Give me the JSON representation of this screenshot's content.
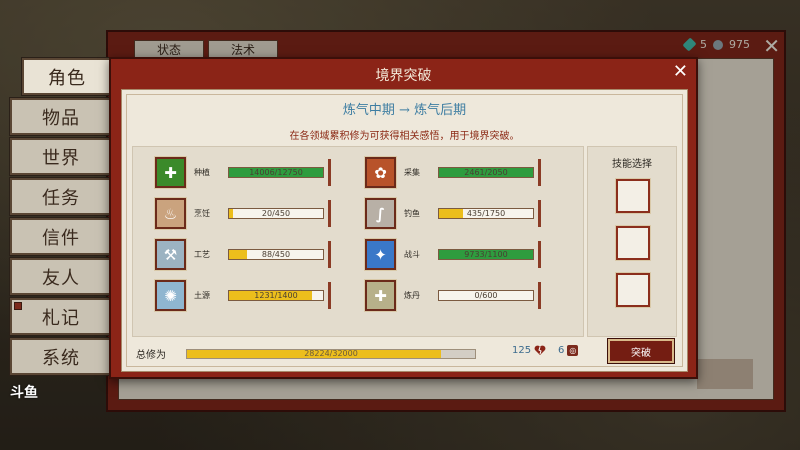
{
  "nav": {
    "items": [
      {
        "label": "角色",
        "active": true
      },
      {
        "label": "物品"
      },
      {
        "label": "世界"
      },
      {
        "label": "任务"
      },
      {
        "label": "信件"
      },
      {
        "label": "友人"
      },
      {
        "label": "札记",
        "marked": true
      },
      {
        "label": "系统"
      }
    ]
  },
  "corner_logo": "斗鱼",
  "back_window": {
    "tabs": [
      "状态",
      "法术"
    ],
    "gems": "5",
    "coins": "975",
    "close": "✕"
  },
  "dialog": {
    "title": "境界突破",
    "close": "✕",
    "realm": "炼气中期 → 炼气后期",
    "hint": "在各领域累积修为可获得相关感悟，用于境界突破。",
    "skills": [
      {
        "name": "种植",
        "current": 14006,
        "max": 12750,
        "progress_text": "14006/12750",
        "fill": 1.0,
        "bar_color": "#2e9c3e",
        "icon": "plant-plus-icon",
        "icon_bg": "#3b8a2a",
        "glyph": "✚"
      },
      {
        "name": "采集",
        "current": 2461,
        "max": 2050,
        "progress_text": "2461/2050",
        "fill": 1.0,
        "bar_color": "#2e9c3e",
        "icon": "gather-icon",
        "icon_bg": "#b8532a",
        "glyph": "✿"
      },
      {
        "name": "烹饪",
        "current": 20,
        "max": 450,
        "progress_text": "20/450",
        "fill": 0.044,
        "bar_color": "#ecbe1c",
        "icon": "cooking-icon",
        "icon_bg": "#caa37e",
        "glyph": "♨"
      },
      {
        "name": "钓鱼",
        "current": 435,
        "max": 1750,
        "progress_text": "435/1750",
        "fill": 0.25,
        "bar_color": "#ecbe1c",
        "icon": "fishing-icon",
        "icon_bg": "#b8b0a6",
        "glyph": "∫"
      },
      {
        "name": "工艺",
        "current": 88,
        "max": 450,
        "progress_text": "88/450",
        "fill": 0.196,
        "bar_color": "#ecbe1c",
        "icon": "crafting-icon",
        "icon_bg": "#9cb3c2",
        "glyph": "⚒"
      },
      {
        "name": "战斗",
        "current": 9733,
        "max": 1100,
        "progress_text": "9733/1100",
        "fill": 1.0,
        "bar_color": "#2e9c3e",
        "icon": "combat-icon",
        "icon_bg": "#3a78c8",
        "glyph": "✦"
      },
      {
        "name": "土源",
        "current": 1231,
        "max": 1400,
        "progress_text": "1231/1400",
        "fill": 0.879,
        "bar_color": "#ecbe1c",
        "icon": "earth-icon",
        "icon_bg": "#8fb6d0",
        "glyph": "✺"
      },
      {
        "name": "炼丹",
        "current": 0,
        "max": 600,
        "progress_text": "0/600",
        "fill": 0.0,
        "bar_color": "#ecbe1c",
        "icon": "alchemy-icon",
        "icon_bg": "#b7b08a",
        "glyph": "✚"
      }
    ],
    "skill_select": {
      "title": "技能选择",
      "slots": 3
    },
    "total": {
      "label": "总修为",
      "current": 28224,
      "max": 32000,
      "progress_text": "28224/32000",
      "fill": 0.882
    },
    "hearts": "125",
    "badges": "6",
    "breakthrough_label": "突破"
  }
}
